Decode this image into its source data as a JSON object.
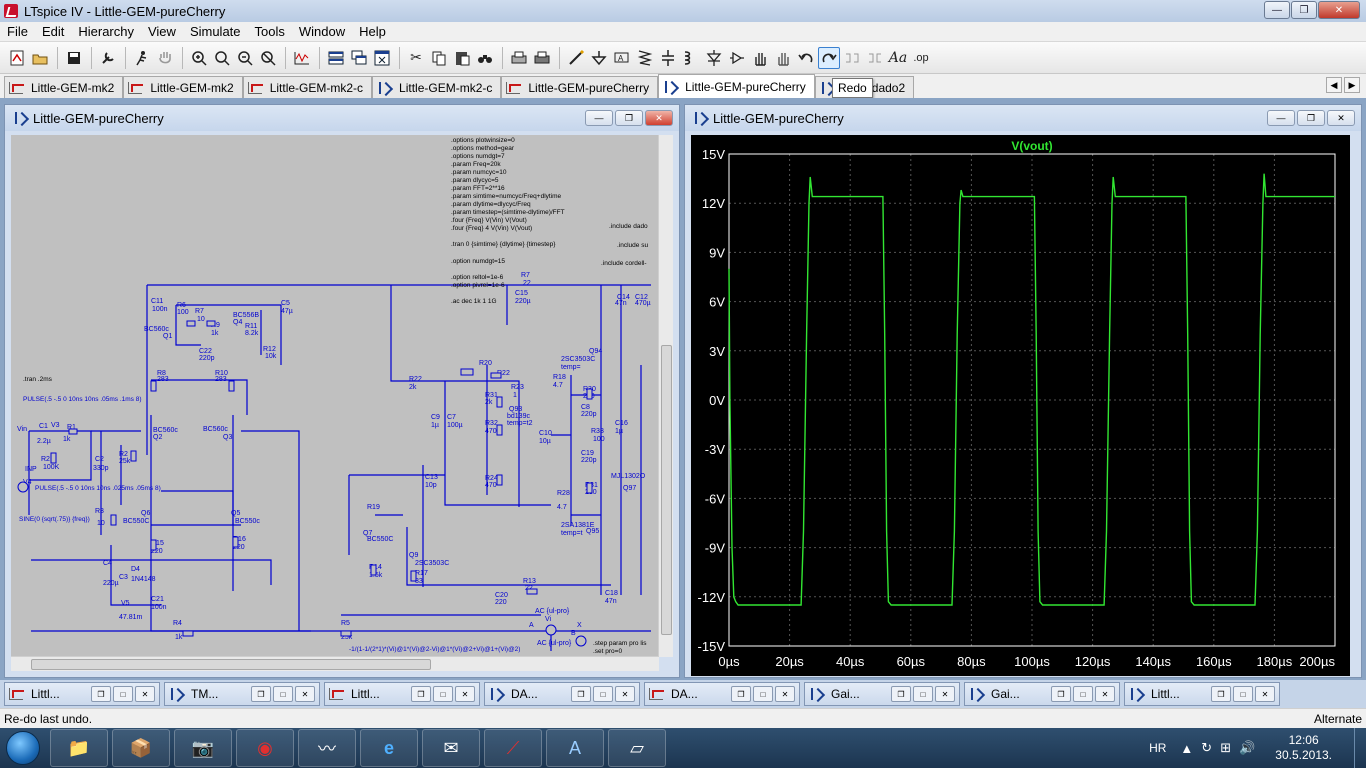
{
  "window": {
    "title": "LTspice IV - Little-GEM-pureCherry",
    "buttons": {
      "minimize": "—",
      "restore": "❐",
      "close": "✕"
    }
  },
  "menu": [
    "File",
    "Edit",
    "Hierarchy",
    "View",
    "Simulate",
    "Tools",
    "Window",
    "Help"
  ],
  "toolbar_icons": [
    "new-schematic-icon",
    "open-icon",
    "save-icon",
    "control-panel-icon",
    "run-icon",
    "halt-icon",
    "zoom-in-icon",
    "zoom-pan-icon",
    "zoom-out-icon",
    "zoom-fit-icon",
    "waveform-icon",
    "tile-horizontal-icon",
    "cascade-icon",
    "close-windows-icon",
    "cut-icon",
    "copy-icon",
    "paste-icon",
    "find-icon",
    "print-preview-icon",
    "print-icon",
    "wire-icon",
    "ground-icon",
    "label-icon",
    "resistor-icon",
    "capacitor-icon",
    "inductor-icon",
    "diode-icon",
    "component-icon",
    "move-icon",
    "drag-icon",
    "undo-icon",
    "redo-icon",
    "rotate-icon",
    "mirror-icon",
    "text-icon",
    "spice-directive-icon"
  ],
  "tabs": [
    {
      "label": "Little-GEM-mk2",
      "type": "wave"
    },
    {
      "label": "Little-GEM-mk2",
      "type": "wave"
    },
    {
      "label": "Little-GEM-mk2-c",
      "type": "wave"
    },
    {
      "label": "Little-GEM-mk2-c",
      "type": "sch"
    },
    {
      "label": "Little-GEM-pureCherry",
      "type": "wave"
    },
    {
      "label": "Little-GEM-pureCherry",
      "type": "sch",
      "active": true
    },
    {
      "label": "TMC-dado2",
      "type": "sch"
    }
  ],
  "tooltip": "Redo",
  "schematic_window": {
    "title": "Little-GEM-pureCherry",
    "directives": [
      ".options plotwinsize=0",
      ".options method=gear",
      ".options numdgt=7",
      ".param Freq=20k",
      ".param numcyc=10",
      ".param dlycyc=5",
      ".param FFT=2**16",
      ".param simtime=numcyc/Freq+dlytime",
      ".param dlytime=dlycyc/Freq",
      ".param timestep=(simtime-dlytime)/FFT",
      ".four {Freq} V(Vin) V(Vout)",
      ".four {Freq} 4 V(Vin) V(Vout)",
      ".tran 0 {simtime} {dlytime} {timestep}",
      ".option numdgt=15",
      ".option reltol=1e-6",
      ".option pivrel=1e-6",
      ".ac dec 1k 1 1G"
    ],
    "includes": [
      ".include dado",
      ".include su",
      ".include cordell-"
    ],
    "tran_left": ".tran .2ms",
    "pulse1": "PULSE(.5 -.5 0 10ns 10ns .05ms .1ms 8)",
    "pulse2": "PULSE(.5 -.5 0 10ns 10ns .025ms .05ms 8)",
    "sine": "SINE(0 {sqrt(.75)} {freq})",
    "step": ".step param pro lis",
    "set": ".set pro=0",
    "formula": "-1/(1-1/(2*1)*(Vi)@1*(Vi)@2-Vi)@1*(Vi)@2+Vi)@1+(Vi)@2)",
    "components": [
      {
        "ref": "C11",
        "val": "100n"
      },
      {
        "ref": "R6",
        "val": "100"
      },
      {
        "ref": "R7",
        "val": "10"
      },
      {
        "ref": "R9",
        "val": "1k"
      },
      {
        "ref": "R11",
        "val": "8.2k"
      },
      {
        "ref": "C5",
        "val": "47µ"
      },
      {
        "ref": "R12",
        "val": "10k"
      },
      {
        "ref": "C22",
        "val": "220p"
      },
      {
        "ref": "R8",
        "val": "283"
      },
      {
        "ref": "R10",
        "val": "283"
      },
      {
        "ref": "Q1",
        "val": "BC560c"
      },
      {
        "ref": "Q4",
        "val": "BC556B"
      },
      {
        "ref": "Q2",
        "val": "BC560c"
      },
      {
        "ref": "Q3",
        "val": "BC560c"
      },
      {
        "ref": "R22",
        "val": "2k"
      },
      {
        "ref": "R20",
        "val": "10"
      },
      {
        "ref": "R7",
        "val": "22"
      },
      {
        "ref": "C15",
        "val": "220µ"
      },
      {
        "ref": "C14",
        "val": "47n"
      },
      {
        "ref": "C12",
        "val": "470µ"
      },
      {
        "ref": "Q94",
        "val": "2SC3503C"
      },
      {
        "ref": "R18",
        "val": "4.7"
      },
      {
        "ref": "R30",
        "val": "280"
      },
      {
        "ref": "C8",
        "val": "220p"
      },
      {
        "ref": "R33",
        "val": "100"
      },
      {
        "ref": "C19",
        "val": "220p"
      },
      {
        "ref": "R31",
        "val": "280"
      },
      {
        "ref": "R28",
        "val": "4.7"
      },
      {
        "ref": "Q95",
        "val": "2SA1381E"
      },
      {
        "ref": "Q97",
        "val": "MJL1302O"
      },
      {
        "ref": "C16",
        "val": "1µ"
      },
      {
        "ref": "C9",
        "val": "1µ"
      },
      {
        "ref": "C7",
        "val": "100µ"
      },
      {
        "ref": "R23",
        "val": "1"
      },
      {
        "ref": "R21",
        "val": "1k"
      },
      {
        "ref": "R32",
        "val": "470"
      },
      {
        "ref": "Q93",
        "val": "bd139c"
      },
      {
        "ref": "C10",
        "val": "10µ"
      },
      {
        "ref": "R24",
        "val": "470"
      },
      {
        "ref": "C13",
        "val": "10p"
      },
      {
        "ref": "R19",
        "val": ""
      },
      {
        "ref": "Q7",
        "val": "BC550C"
      },
      {
        "ref": "Q9",
        "val": "2SC3503C"
      },
      {
        "ref": "R14",
        "val": "1.5k"
      },
      {
        "ref": "R17",
        "val": "33"
      },
      {
        "ref": "R13",
        "val": "22"
      },
      {
        "ref": "C20",
        "val": "220"
      },
      {
        "ref": "C18",
        "val": "47n"
      },
      {
        "ref": "V3",
        "val": ""
      },
      {
        "ref": "R1",
        "val": "1k"
      },
      {
        "ref": "C1",
        "val": "2.2µ"
      },
      {
        "ref": "R2",
        "val": "25k"
      },
      {
        "ref": "C2",
        "val": "330p"
      },
      {
        "ref": "R21",
        "val": "100K"
      },
      {
        "ref": "V4",
        "val": ""
      },
      {
        "ref": "Q6",
        "val": "BC550C"
      },
      {
        "ref": "Q5",
        "val": "BC550c"
      },
      {
        "ref": "R15",
        "val": "220"
      },
      {
        "ref": "R16",
        "val": "220"
      },
      {
        "ref": "R3",
        "val": "10"
      },
      {
        "ref": "C4",
        "val": "220µ"
      },
      {
        "ref": "D4",
        "val": "1N4148"
      },
      {
        "ref": "C3",
        "val": ""
      },
      {
        "ref": "V5",
        "val": "47.81m"
      },
      {
        "ref": "C21",
        "val": "100n"
      },
      {
        "ref": "R4",
        "val": "1k"
      },
      {
        "ref": "R5",
        "val": "25k"
      },
      {
        "ref": "Vi",
        "val": "AC {ul-pro}"
      }
    ],
    "net_labels": [
      "Vin",
      "INP",
      "A",
      "B",
      "X",
      "Vi"
    ]
  },
  "plot_window": {
    "title": "Little-GEM-pureCherry",
    "trace_name": "V(vout)",
    "trace_color": "#32e632",
    "axis_color": "#ffffff",
    "grid_color": "#555555"
  },
  "chart_data": {
    "type": "line",
    "title": "V(vout)",
    "xlabel": "",
    "ylabel": "",
    "xlim": [
      0,
      200
    ],
    "ylim": [
      -15,
      15
    ],
    "x_unit": "µs",
    "y_unit": "V",
    "x_ticks": [
      "0µs",
      "20µs",
      "40µs",
      "60µs",
      "80µs",
      "100µs",
      "120µs",
      "140µs",
      "160µs",
      "180µs",
      "200µs"
    ],
    "y_ticks": [
      "15V",
      "12V",
      "9V",
      "6V",
      "3V",
      "0V",
      "-3V",
      "-6V",
      "-9V",
      "-12V",
      "-15V"
    ],
    "series": [
      {
        "name": "V(vout)",
        "x": [
          0,
          0.3,
          1,
          1.6,
          2.2,
          3,
          23.8,
          24.6,
          25.6,
          26.4,
          26.8,
          27.5,
          28.5,
          50.8,
          51.4,
          52,
          52.6,
          53.5,
          73.6,
          74.4,
          75.3,
          76.2,
          76.6,
          77.2,
          78.5,
          100.8,
          101.4,
          102,
          102.6,
          103.5,
          123.8,
          124.6,
          125.6,
          126.4,
          126.8,
          127.5,
          128.5,
          150.8,
          151.4,
          152,
          152.6,
          153.5,
          173.6,
          174.4,
          175.3,
          176.2,
          176.6,
          177.2,
          178.5,
          200
        ],
        "y": [
          8,
          0,
          -9,
          -12,
          -12.3,
          -12.5,
          -12.5,
          -8,
          4,
          12,
          13.6,
          12.4,
          12.4,
          12.4,
          4,
          -8,
          -12.3,
          -12.5,
          -12.5,
          -8,
          4,
          12,
          12.8,
          12.4,
          12.4,
          12.4,
          4,
          -8,
          -12.3,
          -12.5,
          -12.5,
          -8,
          4,
          12,
          13.6,
          12.4,
          12.4,
          12.4,
          4,
          -8,
          -12.3,
          -12.5,
          -12.5,
          -8,
          4,
          12,
          13.8,
          12.4,
          12.4,
          12.4
        ]
      }
    ],
    "grid": true
  },
  "mini_windows": [
    {
      "label": "Littl...",
      "type": "wave"
    },
    {
      "label": "TM...",
      "type": "sch"
    },
    {
      "label": "Littl...",
      "type": "wave"
    },
    {
      "label": "DA...",
      "type": "sch"
    },
    {
      "label": "DA...",
      "type": "wave"
    },
    {
      "label": "Gai...",
      "type": "sch"
    },
    {
      "label": "Gai...",
      "type": "sch"
    },
    {
      "label": "Littl...",
      "type": "sch"
    }
  ],
  "status": {
    "left": "Re-do last undo.",
    "right": "Alternate"
  },
  "taskbar": {
    "apps": [
      "explorer-icon",
      "installer-icon",
      "camera-icon",
      "media-icon",
      "scope-icon",
      "ie-icon",
      "outlook-icon",
      "ltspice-icon",
      "word-icon",
      "notepad-icon"
    ],
    "lang": "HR",
    "time": "12:06",
    "date": "30.5.2013."
  }
}
